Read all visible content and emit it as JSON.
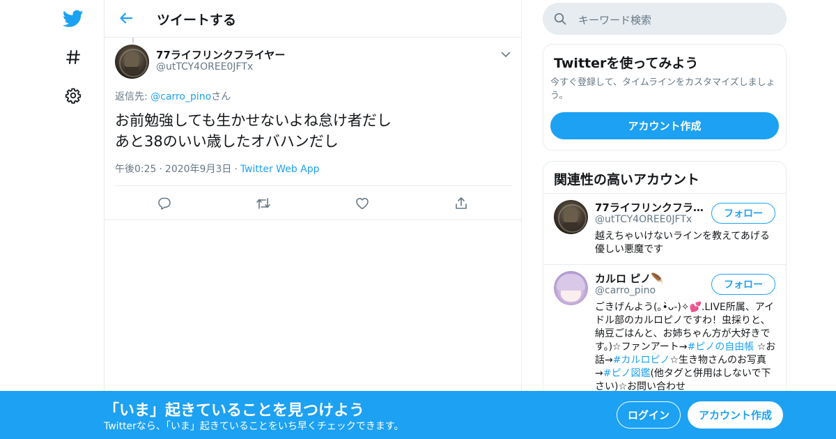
{
  "nav": {
    "icons": [
      "twitter-bird-icon",
      "hashtag-icon",
      "gear-icon"
    ]
  },
  "header": {
    "title": "ツイートする"
  },
  "tweet": {
    "author_name": "77ライフリンクフライヤー",
    "author_handle": "@utTCY4OREE0JFTx",
    "reply_prefix": "返信先: ",
    "reply_user": "@carro_pino",
    "reply_suffix": "さん",
    "text_lines": [
      "お前勉強しても生かせないよね怠け者だし",
      "あと38のいい歳したオバハンだし"
    ],
    "time": "午後0:25",
    "date": "2020年9月3日",
    "source": "Twitter Web App",
    "separator": "·"
  },
  "search": {
    "placeholder": "キーワード検索"
  },
  "signup_card": {
    "title": "Twitterを使ってみよう",
    "description": "今すぐ登録して、タイムラインをカスタマイズしましょう。",
    "button": "アカウント作成"
  },
  "related": {
    "title": "関連性の高いアカウント",
    "accounts": [
      {
        "name": "77ライフリンクフライヤー",
        "handle": "@utTCY4OREE0JFTx",
        "follow": "フォロー",
        "bio": "越えちゃいけないラインを教えてあげる優しい悪魔です"
      },
      {
        "name": "カルロ ピノ🪶",
        "handle": "@carro_pino",
        "follow": "フォロー",
        "bio_parts": [
          {
            "t": "ごきげんよう(｡•̀ᴗ-)✧💕.LIVE所属、アイドル部のカルロピノですわ！虫採りと、納豆ごはんと、お姉ちゃん方が大好きです。)☆ファンアート→",
            "tag": false
          },
          {
            "t": "#ピノの自由帳",
            "tag": true
          },
          {
            "t": " ☆お話→",
            "tag": false
          },
          {
            "t": "#カルロピノ",
            "tag": true
          },
          {
            "t": "☆生き物さんのお写真→",
            "tag": false
          },
          {
            "t": "#ピノ図鑑",
            "tag": true
          },
          {
            "t": "(他タグと併用はしないで下さい)☆お問い合わせ",
            "tag": false
          }
        ]
      }
    ]
  },
  "banner": {
    "title": "「いま」起きていることを見つけよう",
    "subtitle": "Twitterなら、「いま」起きていることをいち早くチェックできます。",
    "login": "ログイン",
    "signup": "アカウント作成"
  },
  "colors": {
    "accent": "#1da1f2",
    "border": "#e6ecf0",
    "muted": "#657786",
    "text": "#14171a"
  }
}
